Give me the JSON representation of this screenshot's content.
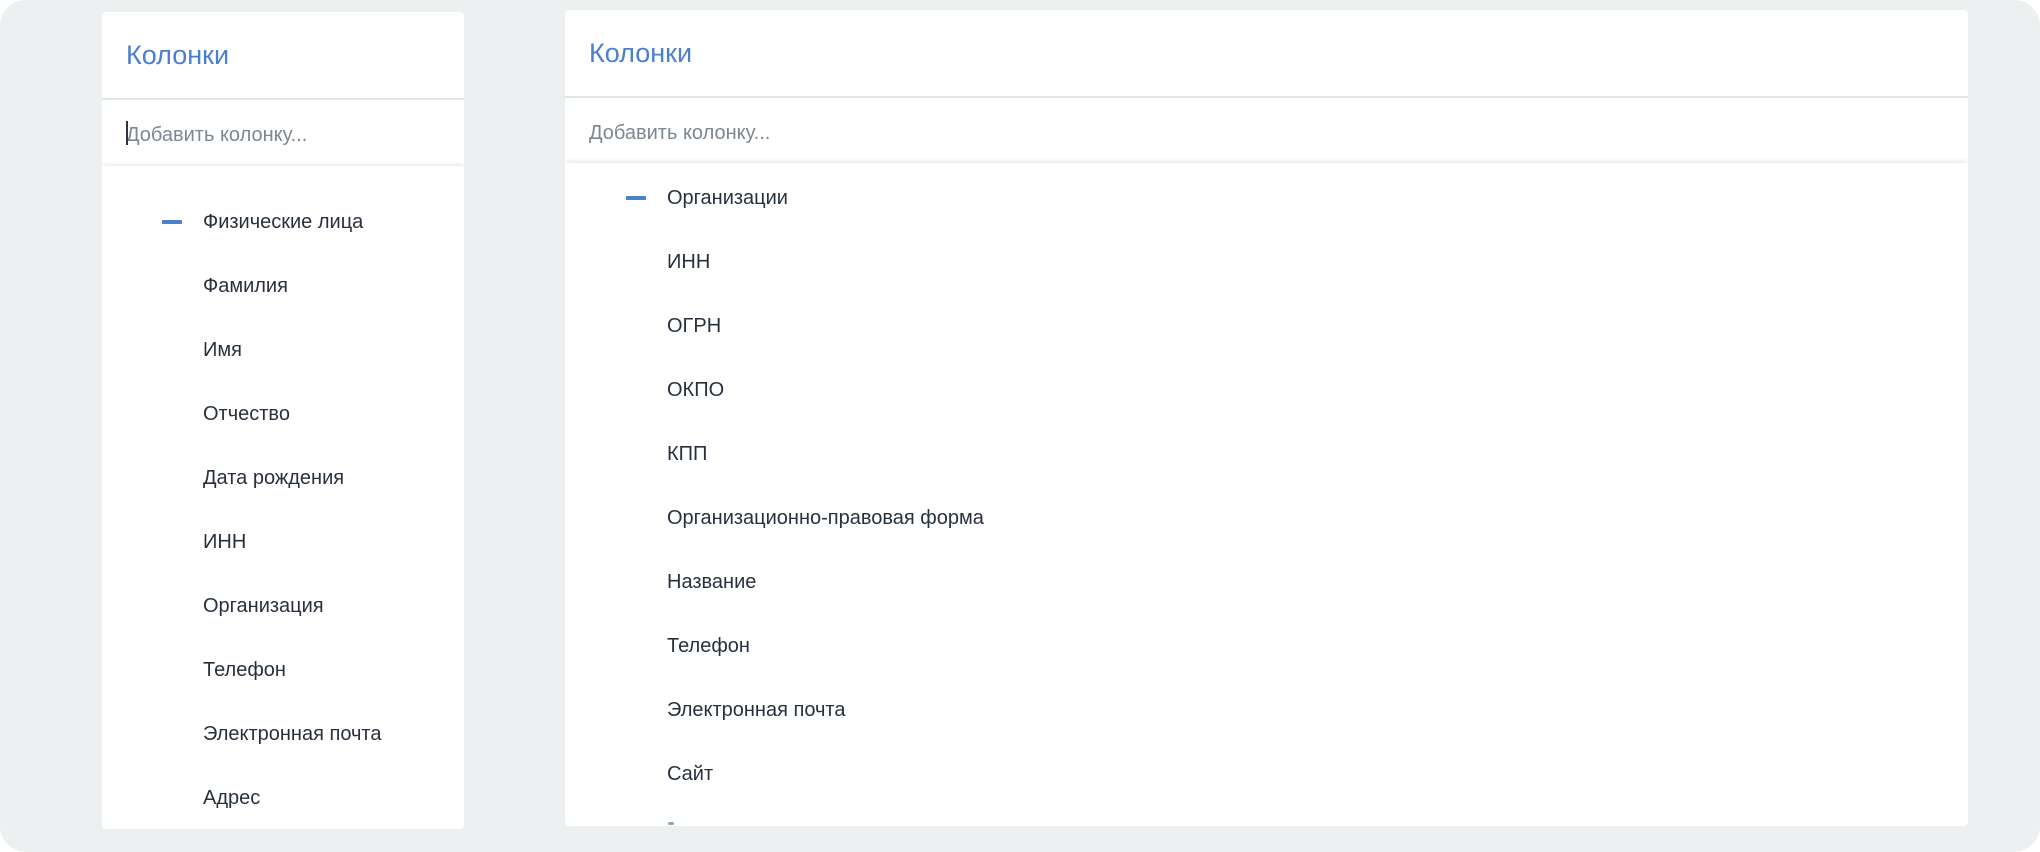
{
  "panels": [
    {
      "title": "Колонки",
      "search_placeholder": "Добавить колонку...",
      "group": "Физические лица",
      "items": [
        "Фамилия",
        "Имя",
        "Отчество",
        "Дата рождения",
        "ИНН",
        "Организация",
        "Телефон",
        "Электронная почта",
        "Адрес"
      ]
    },
    {
      "title": "Колонки",
      "search_placeholder": "Добавить колонку...",
      "group": "Организации",
      "items": [
        "ИНН",
        "ОГРН",
        "ОКПО",
        "КПП",
        "Организационно-правовая форма",
        "Название",
        "Телефон",
        "Электронная почта",
        "Сайт"
      ]
    }
  ]
}
